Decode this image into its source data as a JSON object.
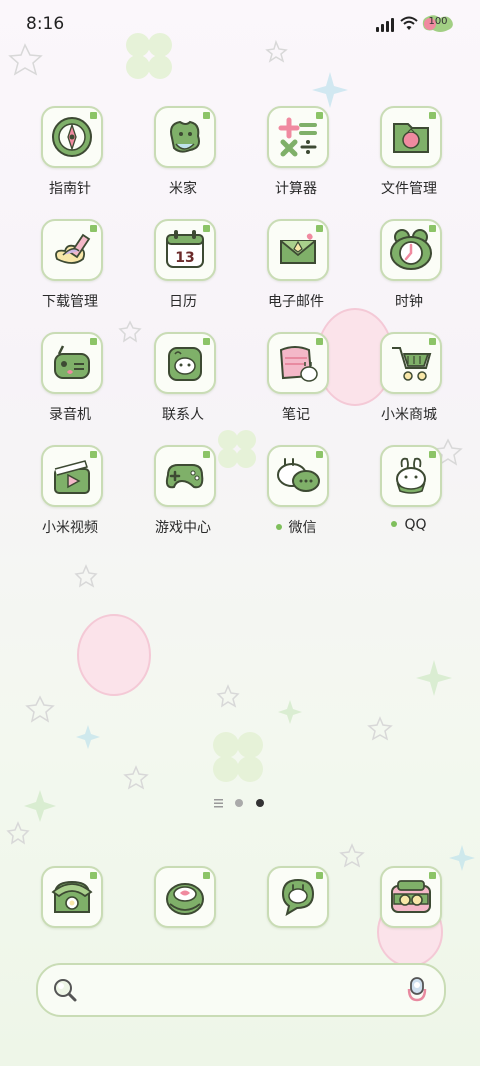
{
  "status_bar": {
    "time": "8:16",
    "battery": "100"
  },
  "apps": [
    {
      "name": "compass",
      "label": "指南针",
      "dot": false
    },
    {
      "name": "mijia",
      "label": "米家",
      "dot": false
    },
    {
      "name": "calculator",
      "label": "计算器",
      "dot": false
    },
    {
      "name": "file-manager",
      "label": "文件管理",
      "dot": false
    },
    {
      "name": "download-manager",
      "label": "下载管理",
      "dot": false
    },
    {
      "name": "calendar",
      "label": "日历",
      "dot": false
    },
    {
      "name": "email",
      "label": "电子邮件",
      "dot": false
    },
    {
      "name": "clock",
      "label": "时钟",
      "dot": false
    },
    {
      "name": "recorder",
      "label": "录音机",
      "dot": false
    },
    {
      "name": "contacts",
      "label": "联系人",
      "dot": false
    },
    {
      "name": "notes",
      "label": "笔记",
      "dot": false
    },
    {
      "name": "mi-store",
      "label": "小米商城",
      "dot": false
    },
    {
      "name": "mi-video",
      "label": "小米视频",
      "dot": false
    },
    {
      "name": "game-center",
      "label": "游戏中心",
      "dot": false
    },
    {
      "name": "wechat",
      "label": "微信",
      "dot": true
    },
    {
      "name": "qq",
      "label": "QQ",
      "dot": true
    }
  ],
  "calendar_day": "13",
  "page_indicator": {
    "pages": 2,
    "current": 2
  },
  "dock": [
    "phone-icon",
    "browser-icon",
    "messages-icon",
    "camera-icon"
  ],
  "colors": {
    "accent": "#8cc467",
    "tile_border": "#c9dcb5",
    "icon_green": "#7fb069"
  }
}
